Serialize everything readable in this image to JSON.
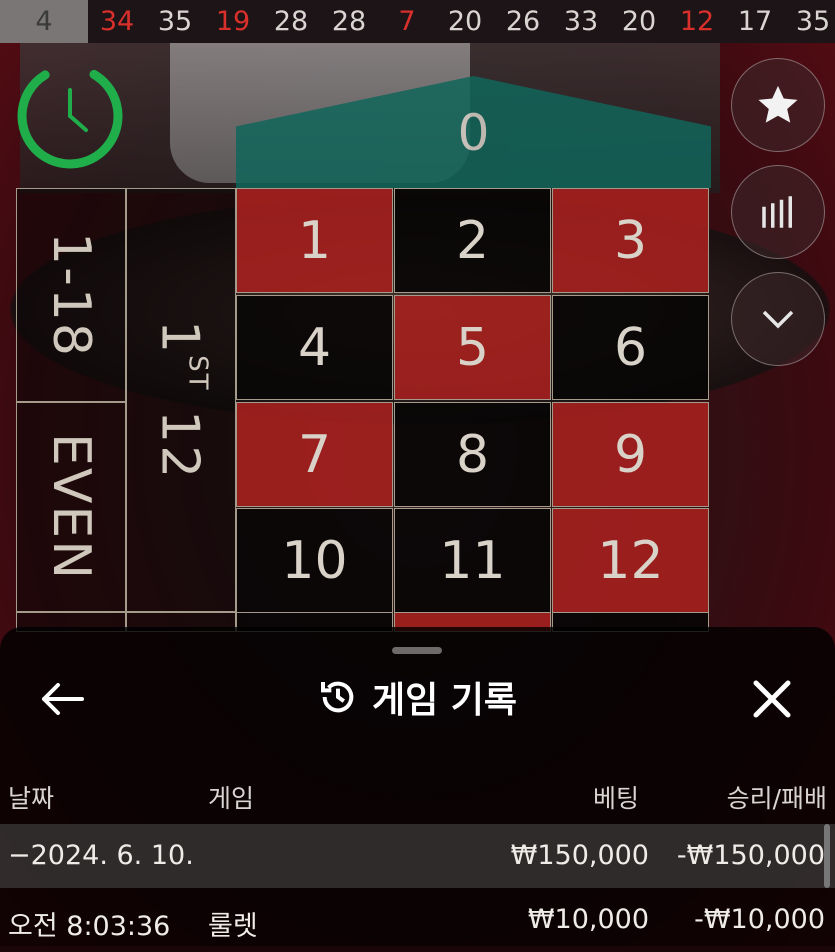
{
  "results": [
    {
      "value": "4",
      "color": "green"
    },
    {
      "value": "34",
      "color": "red"
    },
    {
      "value": "35",
      "color": "black"
    },
    {
      "value": "19",
      "color": "red"
    },
    {
      "value": "28",
      "color": "black"
    },
    {
      "value": "28",
      "color": "black"
    },
    {
      "value": "7",
      "color": "red"
    },
    {
      "value": "20",
      "color": "black"
    },
    {
      "value": "26",
      "color": "black"
    },
    {
      "value": "33",
      "color": "black"
    },
    {
      "value": "20",
      "color": "black"
    },
    {
      "value": "12",
      "color": "red"
    },
    {
      "value": "17",
      "color": "black"
    },
    {
      "value": "35",
      "color": "black"
    }
  ],
  "table": {
    "zero": "0",
    "numbers": [
      {
        "n": "1",
        "color": "red"
      },
      {
        "n": "2",
        "color": "black"
      },
      {
        "n": "3",
        "color": "red"
      },
      {
        "n": "4",
        "color": "black"
      },
      {
        "n": "5",
        "color": "red"
      },
      {
        "n": "6",
        "color": "black"
      },
      {
        "n": "7",
        "color": "red"
      },
      {
        "n": "8",
        "color": "black"
      },
      {
        "n": "9",
        "color": "red"
      },
      {
        "n": "10",
        "color": "black"
      },
      {
        "n": "11",
        "color": "black"
      },
      {
        "n": "12",
        "color": "red"
      }
    ],
    "low_label": "1-18",
    "even_label": "EVEN",
    "dozen_main": "1",
    "dozen_sup": "ST",
    "dozen_num": "12"
  },
  "side_buttons": {
    "favorite_icon": "star-icon",
    "stats_icon": "bar-chart-icon",
    "collapse_icon": "chevron-down-icon"
  },
  "history": {
    "title": "게임 기록",
    "columns": {
      "date": "날짜",
      "game": "게임",
      "bet": "베팅",
      "winloss": "승리/패배"
    },
    "date_row": {
      "date": "−2024. 6. 10.",
      "bet": "₩150,000",
      "winloss": "-₩150,000"
    },
    "rows": [
      {
        "time": "오전 8:03:36",
        "game": "룰렛",
        "bet": "₩10,000",
        "winloss": "-₩10,000"
      }
    ]
  },
  "colors": {
    "red": "#d9302c",
    "green_timer": "#1fae4a",
    "table_red": "#a5201e",
    "zero_green": "#11655a"
  }
}
